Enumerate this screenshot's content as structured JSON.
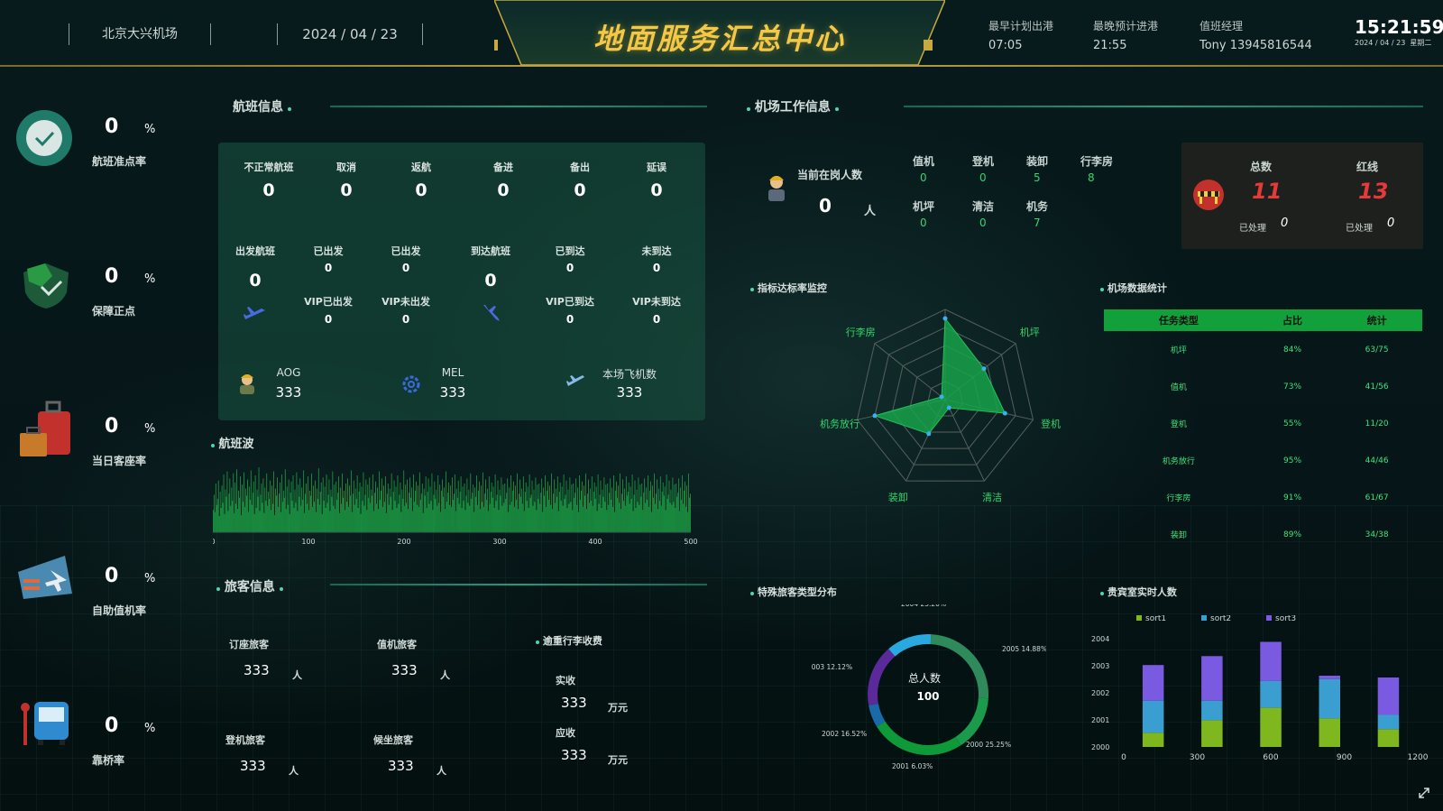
{
  "header": {
    "airport": "北京大兴机场",
    "date": "2024 / 04 / 23",
    "title": "地面服务汇总中心",
    "info": [
      {
        "label": "最早计划出港",
        "value": "07:05"
      },
      {
        "label": "最晚预计进港",
        "value": "21:55"
      },
      {
        "label": "值班经理",
        "value": "Tony 13945816544"
      }
    ],
    "clock": "15:21:59",
    "clock_date": "2024 / 04 / 23",
    "clock_sub": "星期二"
  },
  "kpis": [
    {
      "value": "0",
      "unit": "%",
      "label": "航班准点率",
      "icon": "check-clock-icon"
    },
    {
      "value": "0",
      "unit": "%",
      "label": "保障正点",
      "icon": "shield-check-icon"
    },
    {
      "value": "0",
      "unit": "%",
      "label": "当日客座率",
      "icon": "luggage-icon"
    },
    {
      "value": "0",
      "unit": "%",
      "label": "自助值机率",
      "icon": "ticket-plane-icon"
    },
    {
      "value": "0",
      "unit": "%",
      "label": "靠桥率",
      "icon": "bus-icon"
    }
  ],
  "flight": {
    "title": "航班信息",
    "top": [
      {
        "label": "不正常航班",
        "value": "0"
      },
      {
        "label": "取消",
        "value": "0"
      },
      {
        "label": "返航",
        "value": "0"
      },
      {
        "label": "备进",
        "value": "0"
      },
      {
        "label": "备出",
        "value": "0"
      },
      {
        "label": "延误",
        "value": "0"
      }
    ],
    "departure": {
      "label": "出发航班",
      "value": "0",
      "items": [
        {
          "label": "已出发",
          "value": "0"
        },
        {
          "label": "已出发",
          "value": "0"
        },
        {
          "label": "VIP已出发",
          "value": "0"
        },
        {
          "label": "VIP未出发",
          "value": "0"
        }
      ]
    },
    "arrival": {
      "label": "到达航班",
      "value": "0",
      "items": [
        {
          "label": "已到达",
          "value": "0"
        },
        {
          "label": "未到达",
          "value": "0"
        },
        {
          "label": "VIP已到达",
          "value": "0"
        },
        {
          "label": "VIP未到达",
          "value": "0"
        }
      ]
    },
    "bottom": [
      {
        "label": "AOG",
        "value": "333",
        "icon": "worker-icon"
      },
      {
        "label": "MEL",
        "value": "333",
        "icon": "gear-icon"
      },
      {
        "label": "本场飞机数",
        "value": "333",
        "icon": "plane-icon"
      }
    ]
  },
  "wave": {
    "title": "航班波",
    "ticks": [
      "0",
      "100",
      "200",
      "300",
      "400",
      "500"
    ],
    "bars": [
      22,
      37,
      20,
      48,
      27,
      33,
      51,
      16,
      40,
      24,
      46,
      29,
      57,
      18,
      42,
      35,
      60,
      21,
      38,
      53,
      26,
      44,
      31,
      58,
      19,
      49,
      28,
      62,
      23,
      41,
      34,
      55,
      17,
      47,
      30,
      59,
      25,
      43,
      36,
      52,
      20,
      45,
      32,
      61,
      27,
      39,
      50,
      18,
      56,
      24,
      42,
      35,
      64,
      21,
      37,
      48,
      29,
      53,
      19,
      44,
      31,
      58,
      26,
      40,
      33,
      51,
      22,
      46,
      28,
      60,
      17,
      43,
      36,
      54,
      25,
      38,
      49,
      20,
      57,
      30,
      41,
      34,
      62,
      23,
      45,
      27,
      52,
      18,
      39,
      50,
      31,
      56,
      24,
      42,
      29,
      59,
      21,
      47,
      35,
      53,
      26,
      44,
      32,
      61,
      19,
      38,
      48,
      28,
      55,
      22,
      41,
      36,
      58,
      25,
      46,
      30,
      51,
      20,
      43,
      33,
      63,
      27,
      40,
      49,
      18,
      54,
      31,
      45,
      24,
      57,
      29,
      37,
      52,
      21,
      42,
      35,
      60,
      26,
      47,
      23,
      50,
      32,
      39,
      55,
      19,
      44,
      28,
      58,
      34,
      41,
      22,
      48,
      30,
      53,
      25,
      46,
      36,
      61,
      20,
      38,
      51,
      27,
      43,
      33,
      56,
      24,
      40,
      49,
      18,
      45,
      31,
      59,
      26,
      37,
      52,
      22,
      47,
      34,
      54,
      29,
      42,
      36,
      57,
      21,
      39,
      50,
      28,
      44,
      23,
      60,
      32,
      41,
      53,
      25,
      46,
      30,
      55,
      19,
      38,
      48,
      27,
      43,
      35,
      58,
      22,
      40,
      51,
      31,
      45,
      24,
      56,
      28,
      37,
      49,
      20,
      42,
      33,
      61,
      26,
      47,
      29,
      52,
      23,
      39,
      54,
      34,
      44,
      21,
      57,
      30,
      41,
      50,
      27,
      46,
      25,
      59,
      32,
      38,
      48,
      19,
      43,
      36,
      55,
      24,
      40,
      53,
      28,
      45,
      31,
      58,
      22,
      37,
      50,
      33,
      42,
      26,
      56,
      29,
      47,
      20,
      41,
      52,
      35,
      44,
      23,
      60,
      30,
      39,
      49,
      27,
      46,
      25,
      54,
      32,
      38,
      57,
      21,
      43,
      34,
      51,
      28,
      40,
      55,
      24,
      45,
      31,
      48,
      22,
      36,
      53,
      29,
      42,
      26,
      58,
      33,
      39,
      47,
      20,
      44,
      35,
      56,
      27,
      41,
      50,
      23,
      46,
      30,
      59,
      25,
      38,
      52,
      32,
      43,
      21,
      55,
      28,
      40,
      49,
      34,
      45,
      24,
      57,
      31,
      37,
      51,
      22,
      42,
      36,
      54,
      26,
      47,
      29,
      48,
      33,
      39,
      53,
      20,
      44,
      27,
      56,
      30,
      41,
      50,
      25,
      46,
      32,
      58,
      23,
      38,
      52,
      35,
      43,
      28,
      55,
      21,
      40,
      49,
      31,
      45,
      24,
      57,
      34,
      37,
      51,
      26,
      42,
      30,
      54,
      22,
      47,
      33,
      48,
      28,
      39,
      53,
      20,
      44,
      36,
      56,
      25,
      41,
      50,
      32,
      46,
      27,
      58,
      23,
      38,
      52,
      29,
      43,
      35,
      55,
      21,
      40,
      49,
      31,
      45,
      26,
      57,
      33,
      37,
      51,
      24,
      42,
      28,
      54,
      30,
      47,
      22,
      48,
      34,
      39,
      53,
      27,
      44,
      20,
      56,
      32,
      41,
      50,
      25,
      46,
      36,
      58,
      23,
      38,
      52,
      29,
      43,
      31,
      55,
      26,
      40,
      49,
      33,
      45,
      21,
      57,
      28,
      37,
      51,
      24,
      42,
      35,
      54,
      30,
      47,
      22,
      48,
      27,
      39,
      53,
      32,
      44,
      25,
      56,
      20,
      41,
      50,
      34,
      46,
      29,
      58,
      23,
      38,
      52,
      31,
      43,
      26,
      55,
      36,
      40,
      49,
      28,
      45,
      33,
      57,
      21,
      37,
      51,
      24,
      42,
      30,
      54,
      27,
      47,
      35,
      48,
      22,
      39,
      53,
      29,
      44,
      32,
      56,
      25,
      41,
      50,
      20,
      46,
      34,
      58,
      28,
      38,
      52,
      23,
      43,
      31,
      55,
      26,
      40,
      49,
      36,
      45,
      22,
      57,
      33,
      37,
      51,
      29,
      42,
      27,
      54,
      30,
      47,
      24,
      48,
      35,
      39,
      53,
      21,
      44,
      32,
      56,
      28,
      41,
      50,
      25,
      46,
      20,
      58,
      34,
      38
    ]
  },
  "passenger": {
    "title": "旅客信息",
    "items": [
      {
        "label": "订座旅客",
        "value": "333",
        "unit": "人"
      },
      {
        "label": "值机旅客",
        "value": "333",
        "unit": "人"
      },
      {
        "label": "登机旅客",
        "value": "333",
        "unit": "人"
      },
      {
        "label": "候坐旅客",
        "value": "333",
        "unit": "人"
      }
    ],
    "fee_title": "逾重行李收费",
    "fees": [
      {
        "label": "实收",
        "value": "333",
        "unit": "万元"
      },
      {
        "label": "应收",
        "value": "333",
        "unit": "万元"
      }
    ]
  },
  "work": {
    "title": "机场工作信息",
    "on_duty_label": "当前在岗人数",
    "on_duty_value": "0",
    "on_duty_unit": "人",
    "groups": [
      {
        "label": "值机",
        "value": "0"
      },
      {
        "label": "登机",
        "value": "0"
      },
      {
        "label": "装卸",
        "value": "5"
      },
      {
        "label": "行李房",
        "value": "8"
      },
      {
        "label": "机坪",
        "value": "0"
      },
      {
        "label": "清洁",
        "value": "0"
      },
      {
        "label": "机务",
        "value": "7"
      }
    ],
    "summary": [
      {
        "label": "总数",
        "value": "11",
        "done_label": "已处理",
        "done_value": "0"
      },
      {
        "label": "红线",
        "value": "13",
        "done_label": "已处理",
        "done_value": "0"
      }
    ]
  },
  "radar": {
    "title": "指标达标率监控",
    "axes": [
      "值机",
      "机坪",
      "登机",
      "清洁",
      "装卸",
      "机务放行",
      "行李房"
    ],
    "values": [
      0.9,
      0.55,
      0.68,
      0.1,
      0.42,
      0.8,
      0.05
    ],
    "color": "#17a24a"
  },
  "stats": {
    "title": "机场数据统计",
    "headers": [
      "任务类型",
      "占比",
      "统计"
    ],
    "rows": [
      [
        "机坪",
        "84%",
        "63/75"
      ],
      [
        "值机",
        "73%",
        "41/56"
      ],
      [
        "登机",
        "55%",
        "11/20"
      ],
      [
        "机务放行",
        "95%",
        "44/46"
      ],
      [
        "行李房",
        "91%",
        "61/67"
      ],
      [
        "装卸",
        "89%",
        "34/38"
      ]
    ]
  },
  "special": {
    "title": "特殊旅客类型分布",
    "center_label": "总人数",
    "center_value": "100",
    "chart_data": {
      "type": "pie",
      "labels": [
        "2004 25.20%",
        "2005 14.88%",
        "2000 25.25%",
        "2001 6.03%",
        "2002 16.52%",
        "2003 12.12%"
      ],
      "values": [
        25.2,
        14.88,
        25.25,
        6.03,
        16.52,
        12.12
      ],
      "colors": [
        "#2e8a5a",
        "#1a9a4a",
        "#0f9a3a",
        "#1a6aa8",
        "#5a2a9a",
        "#2aa8e0"
      ]
    }
  },
  "vip": {
    "title": "贵宾室实时人数",
    "chart_data": {
      "type": "bar",
      "stacked": true,
      "orientation": "vertical",
      "categories": [
        "1",
        "2",
        "3",
        "4",
        "5"
      ],
      "series": [
        {
          "name": "sort1",
          "color": "#7fb81e",
          "values": [
            80,
            150,
            220,
            160,
            100
          ]
        },
        {
          "name": "sort2",
          "color": "#3a9ed0",
          "values": [
            180,
            110,
            150,
            220,
            80
          ]
        },
        {
          "name": "sort3",
          "color": "#7a5ae0",
          "values": [
            200,
            250,
            220,
            20,
            210
          ]
        }
      ],
      "x_ticks": [
        "0",
        "300",
        "600",
        "900",
        "1200"
      ],
      "y_ticks": [
        "2000",
        "2001",
        "2002",
        "2003",
        "2004"
      ]
    }
  }
}
